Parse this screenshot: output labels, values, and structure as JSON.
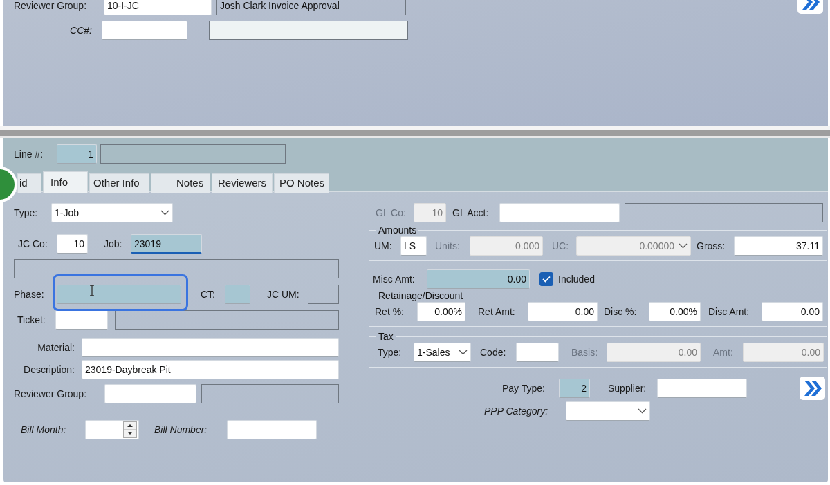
{
  "header": {
    "reviewer_group": {
      "label": "Reviewer Group:",
      "kind": "text",
      "value": "10-I-JC",
      "required": false,
      "disabled": false
    },
    "reviewer_group_name": {
      "kind": "display",
      "value": "Josh Clark Invoice Approval"
    },
    "cc": {
      "label": "CC#:",
      "italic": true,
      "kind": "text",
      "required": false,
      "disabled": false
    },
    "cc_name": {
      "kind": "readonly"
    }
  },
  "line": {
    "label": "Line #:",
    "kind": "text",
    "value": "1",
    "required": true,
    "disabled": false
  },
  "line_desc": {
    "kind": "display"
  },
  "tabs": [
    {
      "label": "id",
      "selected": false
    },
    {
      "label": "Info",
      "selected": true
    },
    {
      "label": "Other Info",
      "selected": false
    },
    {
      "label": "Notes",
      "selected": false
    },
    {
      "label": "Reviewers",
      "selected": false
    },
    {
      "label": "PO Notes",
      "selected": false
    }
  ],
  "info": {
    "type": {
      "label": "Type:",
      "kind": "select",
      "value": "1-Job",
      "disabled": false
    },
    "jc_co": {
      "label": "JC Co:",
      "kind": "text",
      "value": "10",
      "required": false,
      "disabled": false
    },
    "job": {
      "label": "Job:",
      "kind": "text",
      "value": "23019",
      "required": true,
      "disabled": false,
      "focused": true
    },
    "job_desc": {
      "kind": "display"
    },
    "phase": {
      "label": "Phase:",
      "kind": "text",
      "required": true,
      "disabled": false
    },
    "ct": {
      "label": "CT:",
      "kind": "text",
      "required": true,
      "disabled": false
    },
    "jc_um": {
      "label": "JC UM:",
      "kind": "display"
    },
    "ticket": {
      "label": "Ticket:",
      "kind": "text",
      "required": false,
      "disabled": false
    },
    "ticket_desc": {
      "kind": "display"
    },
    "material": {
      "label": "Material:",
      "kind": "text",
      "required": false,
      "disabled": false
    },
    "description": {
      "label": "Description:",
      "kind": "text",
      "value": "23019-Daybreak Pit",
      "required": false,
      "disabled": false
    },
    "reviewer_group": {
      "label": "Reviewer Group:",
      "kind": "text",
      "required": false,
      "disabled": false
    },
    "reviewer_group_name": {
      "kind": "display"
    },
    "bill_month": {
      "label": "Bill Month:",
      "italic": true,
      "kind": "spin"
    },
    "bill_number": {
      "label": "Bill Number:",
      "italic": true,
      "kind": "text",
      "required": false,
      "disabled": false
    },
    "gl_co": {
      "label": "GL Co:",
      "kind": "text",
      "value": "10",
      "disabled": true
    },
    "gl_acct": {
      "label": "GL Acct:",
      "kind": "text",
      "required": false,
      "disabled": false
    },
    "gl_acct_desc": {
      "kind": "display"
    },
    "amounts": {
      "title": "Amounts",
      "um": {
        "label": "UM:",
        "kind": "text",
        "value": "LS",
        "required": false,
        "disabled": false
      },
      "units": {
        "label": "Units:",
        "kind": "text",
        "value": "0.000",
        "disabled": true
      },
      "uc": {
        "label": "UC:",
        "kind": "select",
        "value": "0.00000",
        "disabled": true
      },
      "gross": {
        "label": "Gross:",
        "kind": "text",
        "value": "37.11",
        "required": false,
        "disabled": false
      }
    },
    "misc_amt": {
      "label": "Misc Amt:",
      "kind": "text",
      "value": "0.00",
      "required": true,
      "disabled": false
    },
    "included": {
      "label": "Included",
      "checked": true
    },
    "retainage": {
      "title": "Retainage/Discount",
      "ret_pct": {
        "label": "Ret %:",
        "kind": "text",
        "value": "0.00%",
        "required": false,
        "disabled": false
      },
      "ret_amt": {
        "label": "Ret Amt:",
        "kind": "text",
        "value": "0.00",
        "required": false,
        "disabled": false
      },
      "disc_pct": {
        "label": "Disc %:",
        "kind": "text",
        "value": "0.00%",
        "required": false,
        "disabled": false
      },
      "disc_amt": {
        "label": "Disc Amt:",
        "kind": "text",
        "value": "0.00",
        "required": false,
        "disabled": false
      }
    },
    "tax": {
      "title": "Tax",
      "type": {
        "label": "Type:",
        "kind": "select",
        "value": "1-Sales",
        "disabled": false
      },
      "code": {
        "label": "Code:",
        "kind": "text",
        "required": false,
        "disabled": false
      },
      "basis": {
        "label": "Basis:",
        "kind": "text",
        "value": "0.00",
        "disabled": true
      },
      "amt": {
        "label": "Amt:",
        "kind": "text",
        "value": "0.00",
        "disabled": true
      }
    },
    "pay_type": {
      "label": "Pay Type:",
      "kind": "text",
      "value": "2",
      "required": true,
      "disabled": false
    },
    "supplier": {
      "label": "Supplier:",
      "kind": "text",
      "required": false,
      "disabled": false
    },
    "ppp_category": {
      "label": "PPP Category:",
      "italic": true,
      "kind": "select",
      "disabled": false
    }
  }
}
